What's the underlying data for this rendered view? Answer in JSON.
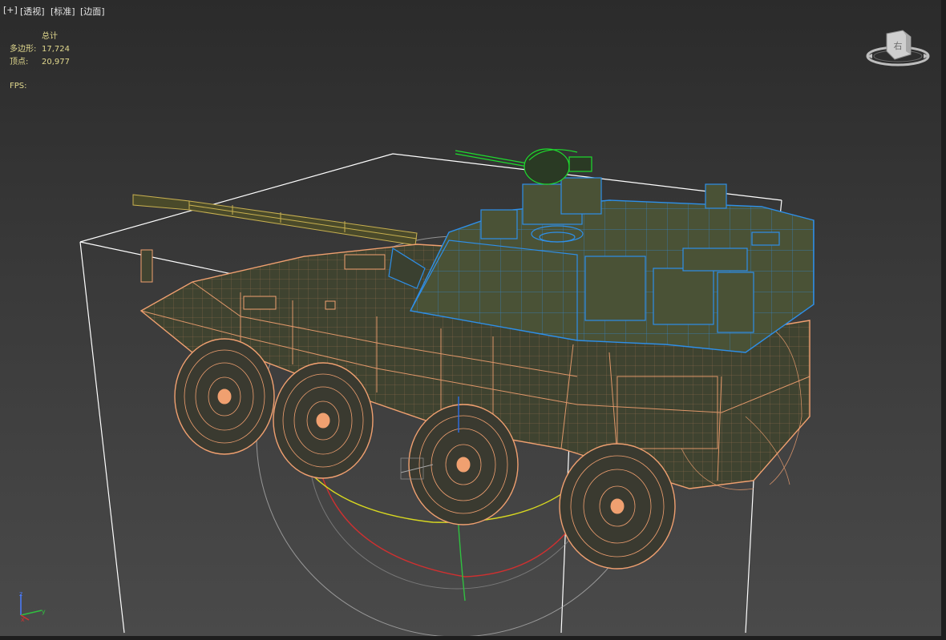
{
  "viewport": {
    "labels": [
      "[+]",
      "[透视]",
      "[标准]",
      "[边面]"
    ]
  },
  "stats": {
    "header": "总计",
    "polygons_label": "多边形:",
    "polygons_value": "17,724",
    "vertices_label": "顶点:",
    "vertices_value": "20,977",
    "fps_label": "FPS:"
  },
  "viewcube": {
    "face": "右"
  },
  "axis_tripod": {
    "z": "z",
    "x": "x",
    "y": "y"
  },
  "colors": {
    "background_top": "#2b2b2b",
    "background_bottom": "#4a4a4a",
    "stats_text": "#e2d98e",
    "hull_wire": "#f0a070",
    "turret_wire": "#2e8fe8",
    "gun_mount_wire": "#1edc2e",
    "bbox": "#ffffff",
    "gizmo_x": "#d03030",
    "gizmo_y": "#d8d820",
    "gizmo_z": "#30c040",
    "hull_fill": "#3f4330"
  }
}
